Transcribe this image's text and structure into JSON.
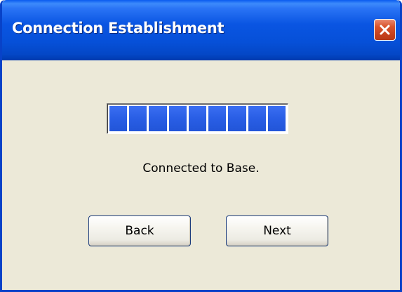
{
  "window": {
    "title": "Connection Establishment",
    "close_icon": "close-icon"
  },
  "progress": {
    "fraction": 1.0,
    "segments_shown": 9
  },
  "status": {
    "text": "Connected to Base."
  },
  "buttons": {
    "back_label": "Back",
    "next_label": "Next"
  },
  "colors": {
    "titlebar": "#0a55e2",
    "window_bg": "#ece9d8",
    "progress_fill": "#2a5fe6",
    "close_button": "#d9532c"
  }
}
